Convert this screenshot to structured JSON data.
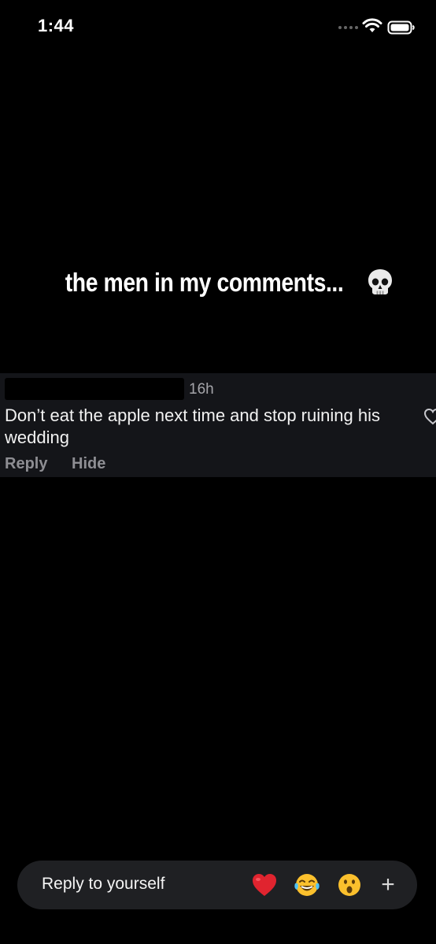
{
  "status_bar": {
    "time": "1:44"
  },
  "story": {
    "caption": "the men in my comments..."
  },
  "comment": {
    "time_ago": "16h",
    "text": "Don’t eat the apple next time and stop ruining his wedding",
    "actions": {
      "reply_label": "Reply",
      "hide_label": "Hide"
    }
  },
  "reply_bar": {
    "placeholder": "Reply to yourself",
    "reactions": [
      "red-heart-emoji",
      "tears-of-joy-emoji",
      "surprised-face-emoji"
    ],
    "plus_label": "+"
  },
  "icons": {
    "wifi": "wifi-icon",
    "battery": "battery-icon",
    "caption_emoji": "skull-icon",
    "comment_like": "heart-outline-icon"
  },
  "colors": {
    "background": "#000000",
    "comment_card": "#141519",
    "reply_bar": "#1f2023",
    "muted_text": "#8e8e93"
  }
}
